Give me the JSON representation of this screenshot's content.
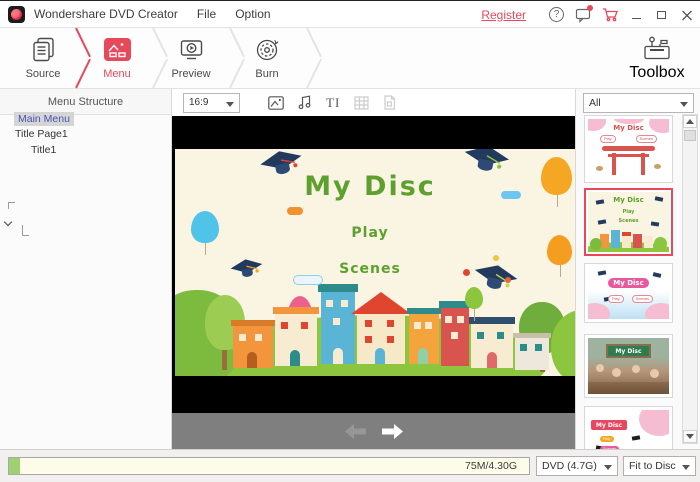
{
  "titlebar": {
    "app_title": "Wondershare DVD Creator",
    "menu_file": "File",
    "menu_option": "Option",
    "register": "Register"
  },
  "icons": {
    "help_glyph": "?"
  },
  "tabs": {
    "source": "Source",
    "menu": "Menu",
    "preview": "Preview",
    "burn": "Burn",
    "toolbox": "Toolbox"
  },
  "left_panel": {
    "header": "Menu Structure",
    "items": [
      {
        "label": "Main Menu",
        "selected": true
      },
      {
        "label": "Title Page1",
        "selected": false
      },
      {
        "label": "Title1",
        "selected": false
      }
    ]
  },
  "stage_toolbar": {
    "aspect_ratio": "16:9",
    "text_tool_glyph": "TI"
  },
  "disc_menu": {
    "title": "My Disc",
    "play": "Play",
    "scenes": "Scenes"
  },
  "templates": {
    "filter_all": "All",
    "button_play": "Play",
    "button_scenes": "Scenes",
    "items": [
      {
        "label": "My Disc",
        "theme": "sakura-torii",
        "selected": false
      },
      {
        "label": "My Disc",
        "theme": "graduation-town",
        "selected": true
      },
      {
        "label": "My Disc",
        "theme": "sakura-sky",
        "selected": false
      },
      {
        "label": "My Disc",
        "theme": "classroom",
        "selected": false
      },
      {
        "label": "My Disc",
        "theme": "sakura-white",
        "selected": false
      }
    ]
  },
  "bottom_bar": {
    "capacity_used": "75M/4.30G",
    "disc_type": "DVD (4.7G)",
    "fit_mode": "Fit to Disc"
  },
  "colors": {
    "accent_red": "#e8495a",
    "disc_text_green": "#5da02e",
    "progress_green": "#9fd170",
    "tree_selected_blue": "#4753b5"
  }
}
